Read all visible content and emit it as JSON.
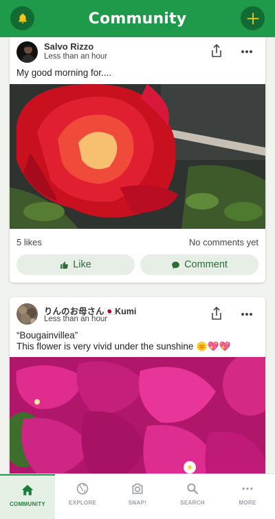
{
  "header": {
    "title": "Community"
  },
  "posts": [
    {
      "author": "Salvo Rizzo",
      "time": "Less than an hour",
      "text": "My good morning for....",
      "likes": "5 likes",
      "comments": "No comments yet",
      "like_label": "Like",
      "comment_label": "Comment"
    },
    {
      "author": "りんのお母さん🇯🇵Kumi",
      "time": "Less than an hour",
      "text_line1": "“Bougainvillea”",
      "text_line2": "This flower is very vivid under the sunshine 🌞💖💖"
    }
  ],
  "tabs": [
    {
      "label": "COMMUNITY",
      "icon": "home-icon",
      "active": true
    },
    {
      "label": "EXPLORE",
      "icon": "globe-icon"
    },
    {
      "label": "SNAP!",
      "icon": "camera-icon"
    },
    {
      "label": "SEARCH",
      "icon": "search-icon"
    },
    {
      "label": "MORE",
      "icon": "more-dots-icon"
    }
  ],
  "colors": {
    "brand_green": "#1f9a4a",
    "dark_green": "#126b32",
    "icon_yellow": "#f5c518"
  }
}
